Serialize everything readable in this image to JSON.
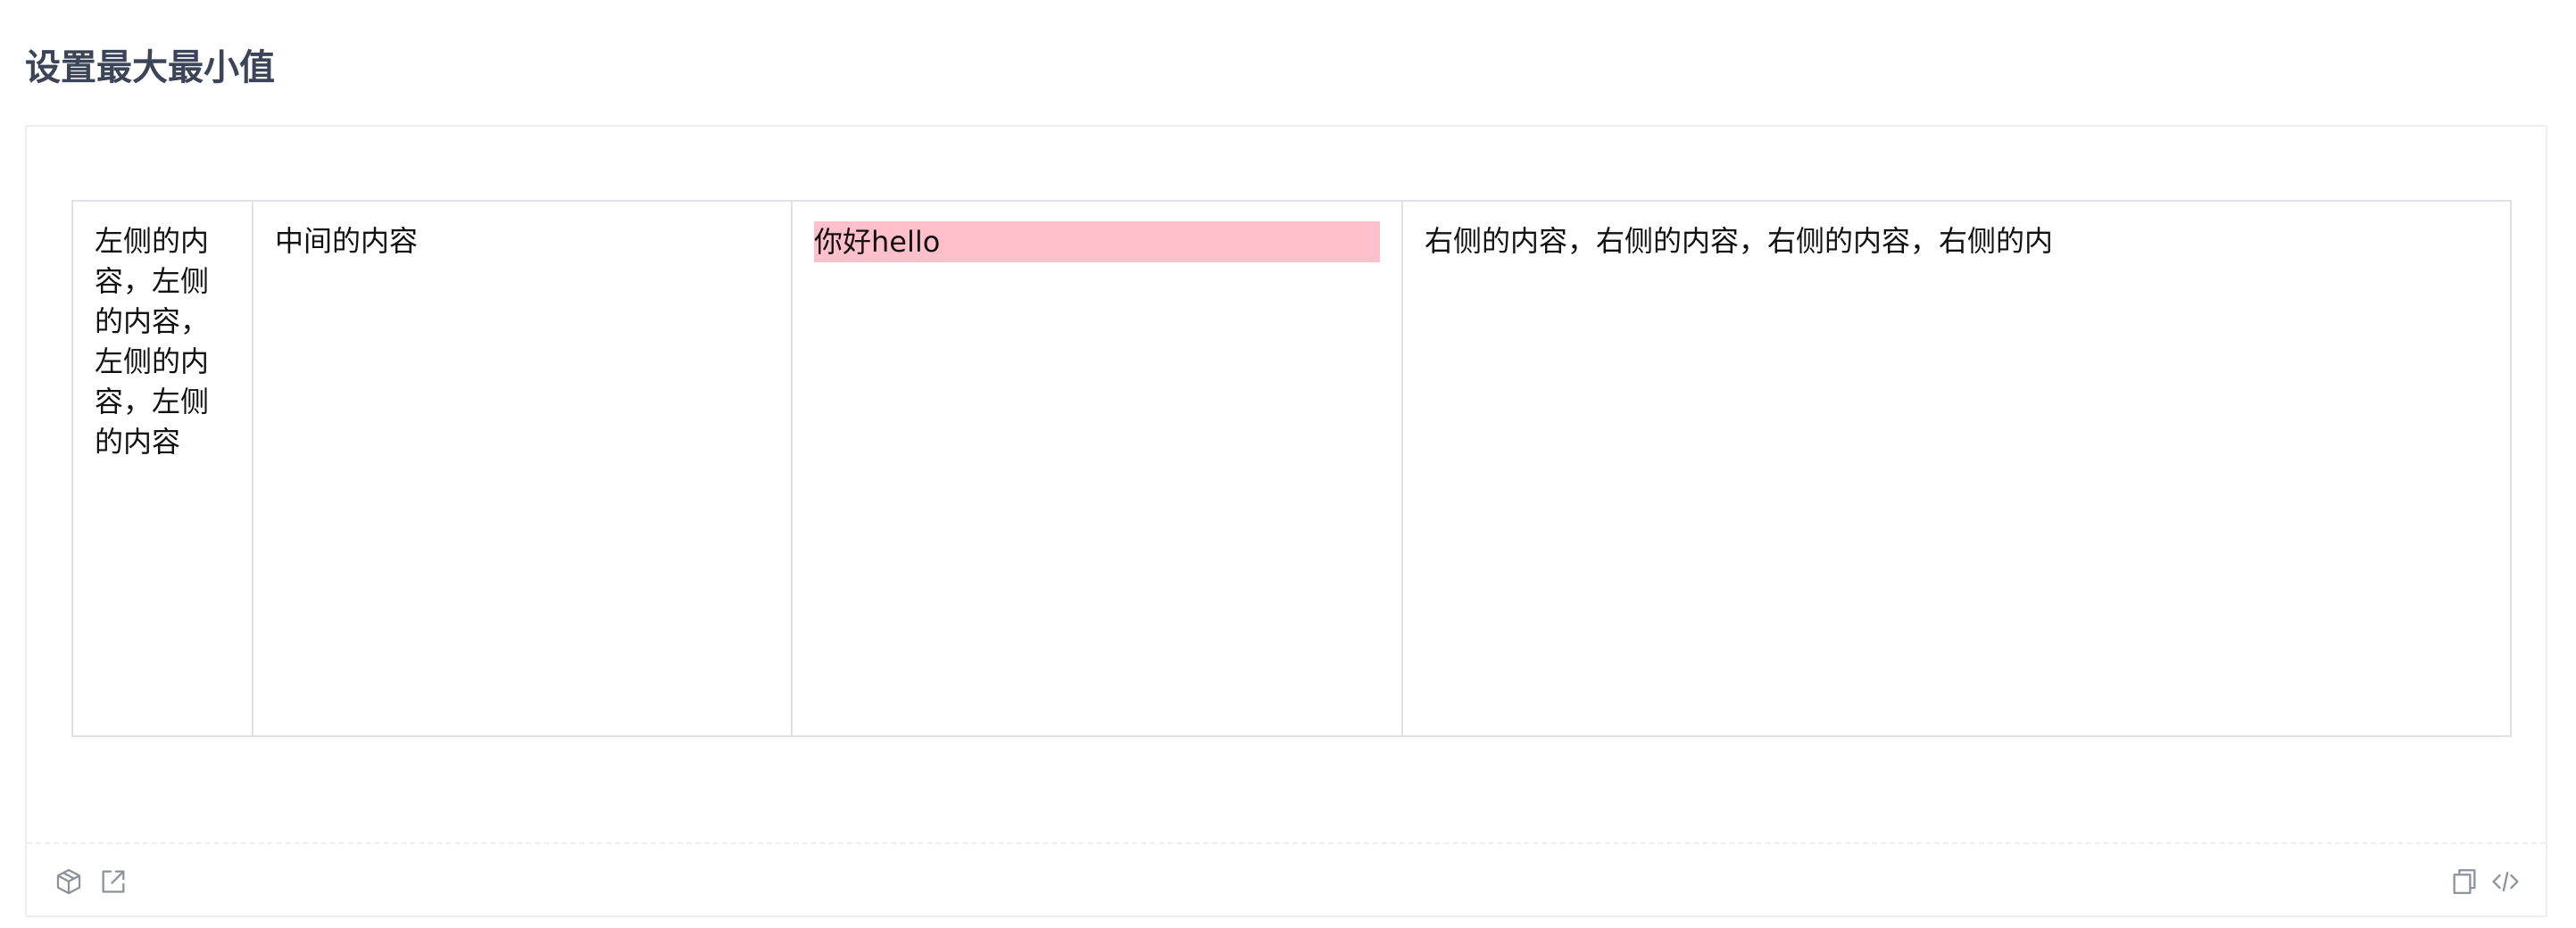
{
  "page": {
    "title": "设置最大最小值"
  },
  "demo": {
    "columns": {
      "left": "左侧的内容，左侧的内容，左侧的内容，左侧的内容",
      "middle": "中间的内容",
      "center": "你好hello",
      "right": "右侧的内容，右侧的内容，右侧的内容，右侧的内"
    },
    "highlight_color": "#ffc0cb"
  },
  "toolbar": {
    "left_icons": [
      "codesandbox-icon",
      "open-external-icon"
    ],
    "right_icons": [
      "copy-icon",
      "code-icon"
    ]
  }
}
